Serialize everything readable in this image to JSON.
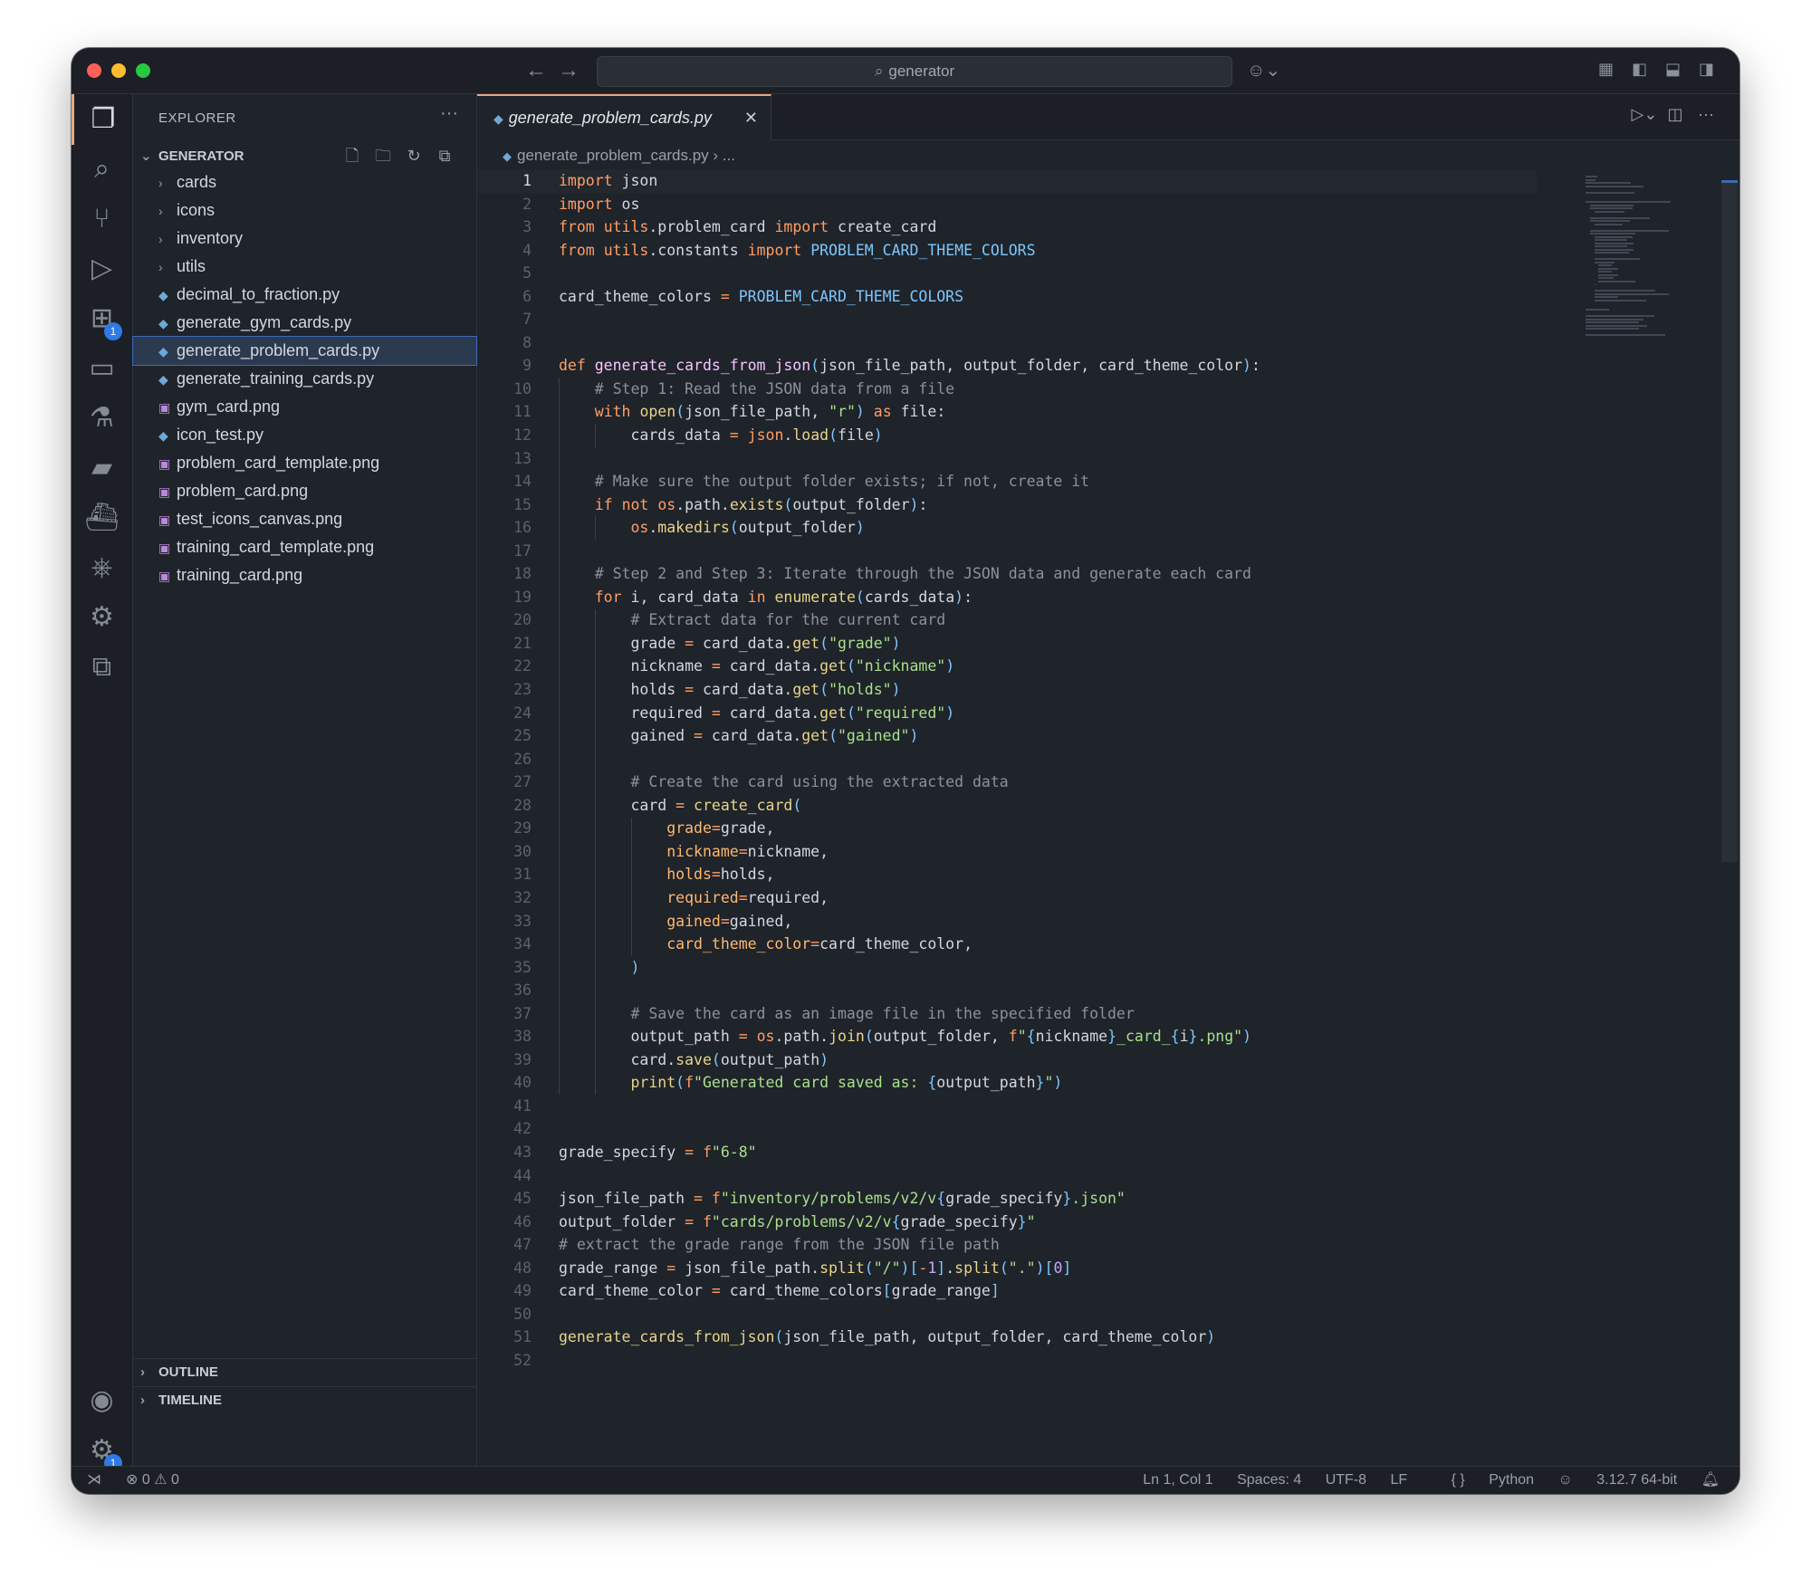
{
  "window": {
    "search_text": "generator"
  },
  "sidebar": {
    "title": "EXPLORER",
    "section": "GENERATOR",
    "items": [
      {
        "label": "cards",
        "type": "folder"
      },
      {
        "label": "icons",
        "type": "folder"
      },
      {
        "label": "inventory",
        "type": "folder"
      },
      {
        "label": "utils",
        "type": "folder"
      },
      {
        "label": "decimal_to_fraction.py",
        "type": "py"
      },
      {
        "label": "generate_gym_cards.py",
        "type": "py"
      },
      {
        "label": "generate_problem_cards.py",
        "type": "py",
        "selected": true
      },
      {
        "label": "generate_training_cards.py",
        "type": "py"
      },
      {
        "label": "gym_card.png",
        "type": "png"
      },
      {
        "label": "icon_test.py",
        "type": "py"
      },
      {
        "label": "problem_card_template.png",
        "type": "png"
      },
      {
        "label": "problem_card.png",
        "type": "png"
      },
      {
        "label": "test_icons_canvas.png",
        "type": "png"
      },
      {
        "label": "training_card_template.png",
        "type": "png"
      },
      {
        "label": "training_card.png",
        "type": "png"
      }
    ],
    "outline_label": "OUTLINE",
    "timeline_label": "TIMELINE"
  },
  "activity_badges": {
    "extensions": "1",
    "settings": "1"
  },
  "editor": {
    "tab_label": "generate_problem_cards.py",
    "breadcrumb_file": "generate_problem_cards.py",
    "breadcrumb_more": "...",
    "lines": [
      "import json",
      "import os",
      "from utils.problem_card import create_card",
      "from utils.constants import PROBLEM_CARD_THEME_COLORS",
      "",
      "card_theme_colors = PROBLEM_CARD_THEME_COLORS",
      "",
      "",
      "def generate_cards_from_json(json_file_path, output_folder, card_theme_color):",
      "    # Step 1: Read the JSON data from a file",
      "    with open(json_file_path, \"r\") as file:",
      "        cards_data = json.load(file)",
      "",
      "    # Make sure the output folder exists; if not, create it",
      "    if not os.path.exists(output_folder):",
      "        os.makedirs(output_folder)",
      "",
      "    # Step 2 and Step 3: Iterate through the JSON data and generate each card",
      "    for i, card_data in enumerate(cards_data):",
      "        # Extract data for the current card",
      "        grade = card_data.get(\"grade\")",
      "        nickname = card_data.get(\"nickname\")",
      "        holds = card_data.get(\"holds\")",
      "        required = card_data.get(\"required\")",
      "        gained = card_data.get(\"gained\")",
      "",
      "        # Create the card using the extracted data",
      "        card = create_card(",
      "            grade=grade,",
      "            nickname=nickname,",
      "            holds=holds,",
      "            required=required,",
      "            gained=gained,",
      "            card_theme_color=card_theme_color,",
      "        )",
      "",
      "        # Save the card as an image file in the specified folder",
      "        output_path = os.path.join(output_folder, f\"{nickname}_card_{i}.png\")",
      "        card.save(output_path)",
      "        print(f\"Generated card saved as: {output_path}\")",
      "",
      "",
      "grade_specify = f\"6-8\"",
      "",
      "json_file_path = f\"inventory/problems/v2/v{grade_specify}.json\"",
      "output_folder = f\"cards/problems/v2/v{grade_specify}\"",
      "# extract the grade range from the JSON file path",
      "grade_range = json_file_path.split(\"/\")[-1].split(\".\")[0]",
      "card_theme_color = card_theme_colors[grade_range]",
      "",
      "generate_cards_from_json(json_file_path, output_folder, card_theme_color)",
      ""
    ]
  },
  "statusbar": {
    "errors": "0",
    "warnings": "0",
    "position": "Ln 1, Col 1",
    "spaces": "Spaces: 4",
    "encoding": "UTF-8",
    "eol": "LF",
    "language": "Python",
    "interpreter": "3.12.7 64-bit"
  }
}
